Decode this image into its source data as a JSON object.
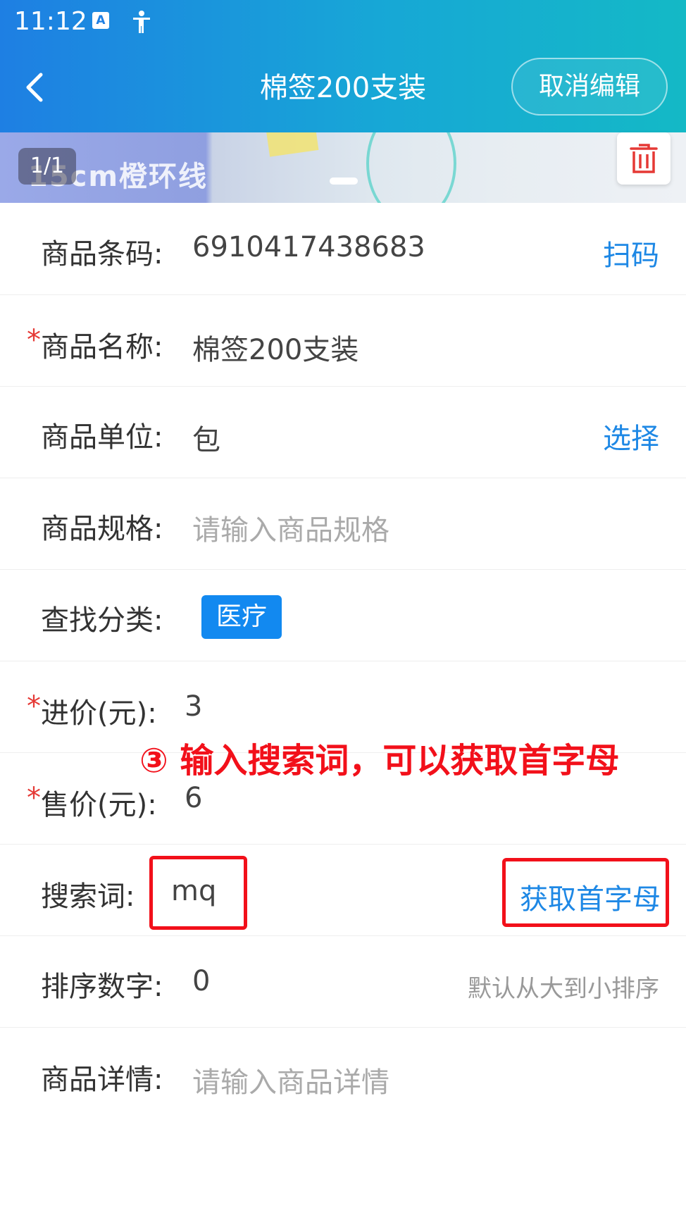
{
  "status_bar": {
    "time": "11:12",
    "icons": [
      "font-a-icon",
      "accessibility-icon"
    ]
  },
  "nav": {
    "title": "棉签200支装",
    "cancel_edit": "取消编辑",
    "back_icon": "chevron-left-icon"
  },
  "banner": {
    "counter": "1/1",
    "image_text": "15cm橙环线",
    "delete_icon": "trash-icon"
  },
  "form": {
    "barcode": {
      "label": "商品条码:",
      "value": "6910417438683",
      "action": "扫码"
    },
    "name": {
      "required": "*",
      "label": "商品名称:",
      "value": "棉签200支装"
    },
    "unit": {
      "label": "商品单位:",
      "value": "包",
      "action": "选择"
    },
    "spec": {
      "label": "商品规格:",
      "placeholder": "请输入商品规格"
    },
    "category": {
      "label": "查找分类:",
      "tag": "医疗"
    },
    "cost_price": {
      "required": "*",
      "label": "进价(元):",
      "value": "3"
    },
    "sale_price": {
      "required": "*",
      "label": "售价(元):",
      "value": "6"
    },
    "search_word": {
      "label": "搜索词:",
      "value": "mq",
      "action": "获取首字母"
    },
    "sort": {
      "label": "排序数字:",
      "value": "0",
      "hint": "默认从大到小排序"
    },
    "detail": {
      "label": "商品详情:",
      "placeholder": "请输入商品详情"
    }
  },
  "annotation": {
    "text": "③ 输入搜索词，可以获取首字母",
    "color": "#f2101a"
  },
  "colors": {
    "header_start": "#1e7fe3",
    "header_end": "#14b9c6",
    "action_blue": "#1e88e5",
    "required_red": "#e53935",
    "chip_blue": "#1289f0"
  }
}
